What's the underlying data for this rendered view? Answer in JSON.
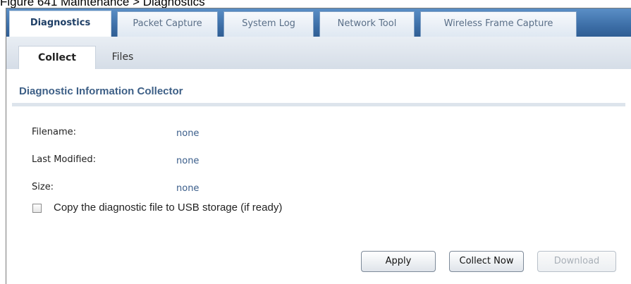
{
  "caption": "Figure 641   Maintenance > Diagnostics",
  "tabs": [
    {
      "label": "Diagnostics",
      "active": true
    },
    {
      "label": "Packet Capture",
      "active": false
    },
    {
      "label": "System Log",
      "active": false
    },
    {
      "label": "Network Tool",
      "active": false
    },
    {
      "label": "Wireless Frame Capture",
      "active": false
    }
  ],
  "subtabs": [
    {
      "label": "Collect",
      "active": true
    },
    {
      "label": "Files",
      "active": false
    }
  ],
  "section": {
    "title": "Diagnostic Information Collector",
    "fields": [
      {
        "label": "Filename:",
        "value": "none"
      },
      {
        "label": "Last Modified:",
        "value": "none"
      },
      {
        "label": "Size:",
        "value": "none"
      }
    ],
    "usb_checkbox": {
      "label": "Copy the diagnostic file to USB storage (if ready)",
      "checked": false
    }
  },
  "buttons": {
    "apply": "Apply",
    "collect_now": "Collect Now",
    "download": "Download"
  },
  "colors": {
    "tabbar": "#3d6fa8",
    "section_title": "#3d5f86",
    "value_text": "#3a5d8a"
  }
}
